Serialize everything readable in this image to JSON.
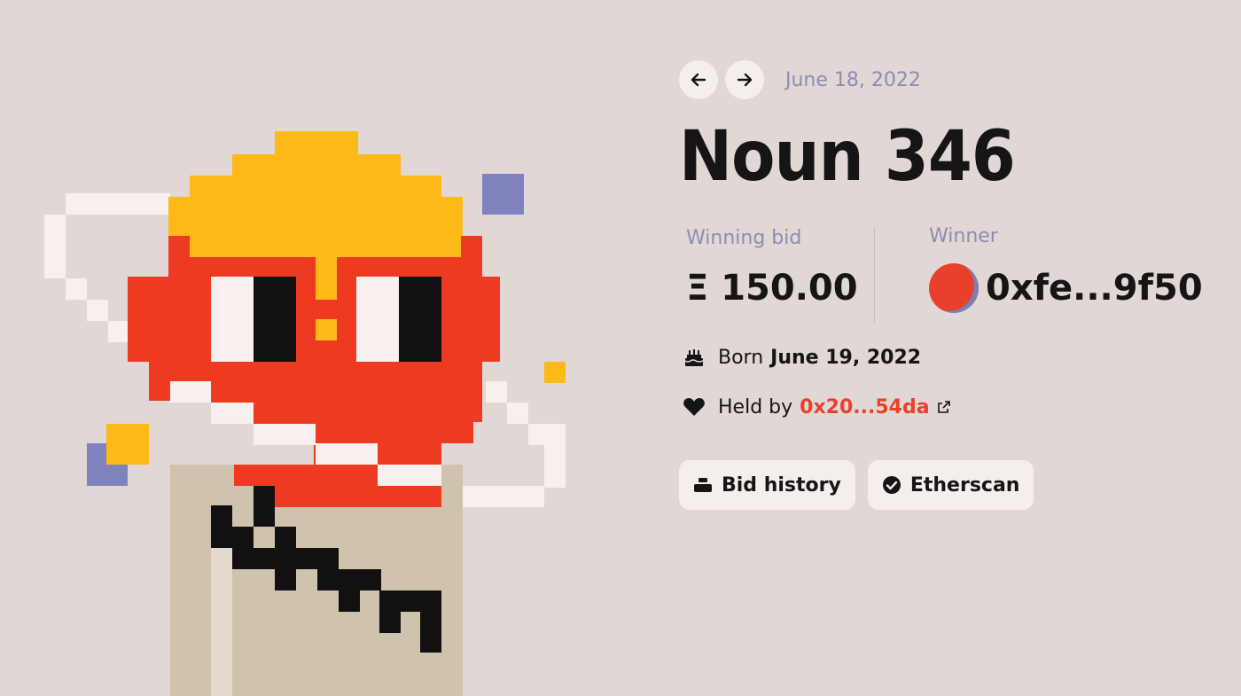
{
  "colors": {
    "background": "#e1d7d5",
    "accent_purple": "#8c8db3",
    "accent_red": "#e8402a",
    "hat_yellow": "#fdb918",
    "body_beige": "#cfc3ad",
    "text_dark": "#151515",
    "button_bg": "#f4eeec"
  },
  "nav": {
    "prev_icon": "arrow-left-icon",
    "next_icon": "arrow-right-icon",
    "date": "June 18, 2022"
  },
  "noun": {
    "title": "Noun 346"
  },
  "auction": {
    "winning_bid_label": "Winning bid",
    "winning_bid_value": "Ξ 150.00",
    "winner_label": "Winner",
    "winner_address": "0xfe...9f50"
  },
  "born": {
    "icon": "cake-icon",
    "prefix": "Born",
    "date": "June 19, 2022"
  },
  "held": {
    "icon": "heart-icon",
    "prefix": "Held by",
    "address": "0x20...54da",
    "link_icon": "external-link-icon"
  },
  "buttons": {
    "bid_history": {
      "label": "Bid history",
      "icon": "stack-icon"
    },
    "etherscan": {
      "label": "Etherscan",
      "icon": "check-badge-icon"
    }
  }
}
